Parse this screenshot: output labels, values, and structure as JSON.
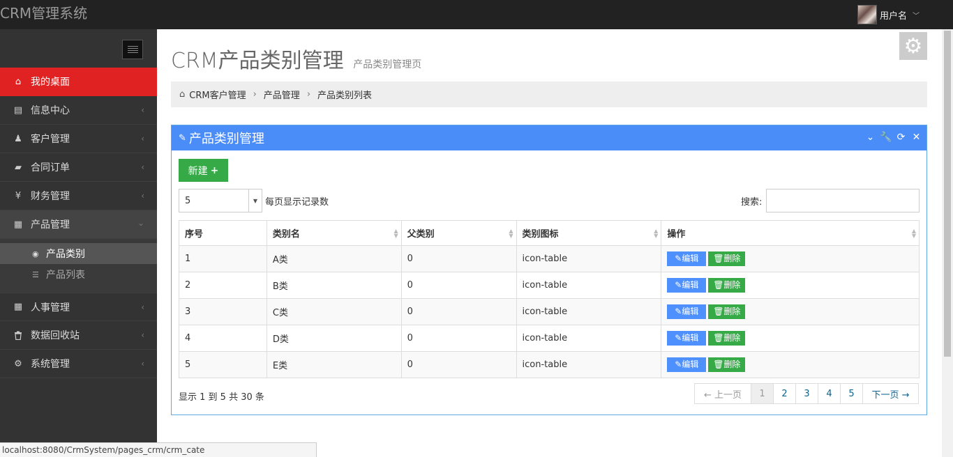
{
  "app": {
    "brand": "CRM管理系统",
    "username": "用户名"
  },
  "sidebar": {
    "items": [
      {
        "label": "我的桌面",
        "icon": "home-icon",
        "glyph": "⌂"
      },
      {
        "label": "信息中心",
        "icon": "calendar-icon",
        "glyph": "▤"
      },
      {
        "label": "客户管理",
        "icon": "male-icon",
        "glyph": "♟"
      },
      {
        "label": "合同订单",
        "icon": "book-icon",
        "glyph": "▰"
      },
      {
        "label": "财务管理",
        "icon": "yen-icon",
        "glyph": "¥"
      },
      {
        "label": "产品管理",
        "icon": "table-icon",
        "glyph": "▦"
      },
      {
        "label": "人事管理",
        "icon": "table-icon",
        "glyph": "▦"
      },
      {
        "label": "数据回收站",
        "icon": "trash-icon",
        "glyph": "🗑"
      },
      {
        "label": "系统管理",
        "icon": "gear-icon",
        "glyph": "⚙"
      }
    ],
    "sub_items": [
      {
        "label": "产品类别",
        "icon": "circle-arrow-icon"
      },
      {
        "label": "产品列表",
        "icon": "list-icon"
      }
    ]
  },
  "page": {
    "title": "CRM产品类别管理",
    "subtitle": "产品类别管理页"
  },
  "breadcrumb": [
    "CRM客户管理",
    "产品管理",
    "产品类别列表"
  ],
  "portlet": {
    "title": "产品类别管理"
  },
  "toolbar": {
    "new_label": "新建",
    "page_length": "5",
    "page_length_label": "每页显示记录数",
    "search_label": "搜索:"
  },
  "table": {
    "headers": [
      "序号",
      "类别名",
      "父类别",
      "类别图标",
      "操作"
    ],
    "rows": [
      [
        "1",
        "A类",
        "0",
        "icon-table"
      ],
      [
        "2",
        "B类",
        "0",
        "icon-table"
      ],
      [
        "3",
        "C类",
        "0",
        "icon-table"
      ],
      [
        "4",
        "D类",
        "0",
        "icon-table"
      ],
      [
        "5",
        "E类",
        "0",
        "icon-table"
      ]
    ],
    "edit_label": "编辑",
    "delete_label": "删除"
  },
  "footer": {
    "info": "显示 1 到 5 共 30 条",
    "prev": "← 上一页",
    "next": "下一页 →",
    "pages": [
      "1",
      "2",
      "3",
      "4",
      "5"
    ],
    "current_page": "1"
  },
  "statusbar": {
    "url": "localhost:8080/CrmSystem/pages_crm/crm_cate"
  },
  "colors": {
    "active_menu": "#e02222",
    "portlet_header": "#4b8df8",
    "success": "#35aa47",
    "primary": "#4d90fe"
  }
}
